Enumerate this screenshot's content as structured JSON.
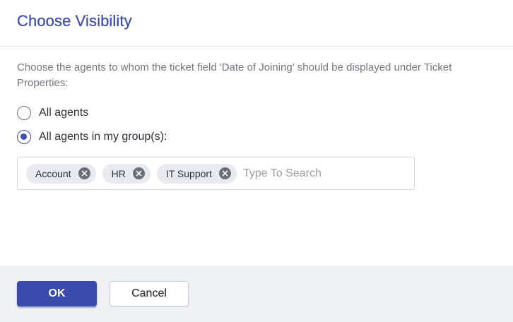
{
  "dialog": {
    "title": "Choose Visibility",
    "description": "Choose the agents to whom the ticket field 'Date of Joining' should be displayed under Ticket Properties:"
  },
  "radios": [
    {
      "label": "All agents",
      "checked": false
    },
    {
      "label": "All agents in my group(s):",
      "checked": true
    }
  ],
  "groups": {
    "tags": [
      {
        "label": "Account",
        "icon": "close-circle-icon"
      },
      {
        "label": "HR",
        "icon": "close-circle-icon"
      },
      {
        "label": "IT Support",
        "icon": "close-circle-icon"
      }
    ],
    "search_value": "",
    "search_placeholder": "Type To Search"
  },
  "footer": {
    "ok_label": "OK",
    "cancel_label": "Cancel"
  },
  "colors": {
    "accent": "#3f4fb0",
    "primary_button": "#3b4bab",
    "footer_bg": "#f0f1f5",
    "tag_bg": "#e8eaf0"
  }
}
